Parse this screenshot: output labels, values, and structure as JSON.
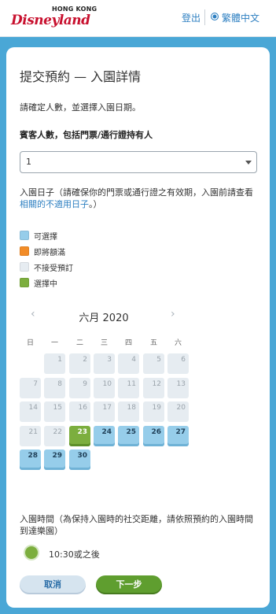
{
  "header": {
    "logo_top": "HONG KONG",
    "logo_main": "Disneyland",
    "logout": "登出",
    "language": "繁體中文"
  },
  "page": {
    "title": "提交預約 — 入園詳情",
    "instruction": "請確定人數，並選擇入園日期。",
    "guest_label": "賓客人數，包括門票/通行證持有人",
    "guest_value": "1",
    "date_note_prefix": "入園日子（請確保你的門票或通行證之有效期，入園前請查看",
    "date_note_link": "相關的不適用日子",
    "date_note_suffix": "。）"
  },
  "legend": [
    {
      "label": "可選擇",
      "color": "#96cdea"
    },
    {
      "label": "即將額滿",
      "color": "#f28c28"
    },
    {
      "label": "不接受預訂",
      "color": "#e6ecf1"
    },
    {
      "label": "選擇中",
      "color": "#7cae3e"
    }
  ],
  "calendar": {
    "month_label": "六月 2020",
    "weekdays": [
      "日",
      "一",
      "二",
      "三",
      "四",
      "五",
      "六"
    ],
    "start_weekday": 1,
    "days_in_month": 30,
    "unavailable_through": 22,
    "selected_day": 23
  },
  "time": {
    "note": "入園時間（為保持入園時的社交距離，請依照預約的入園時間到達樂園）",
    "option": "10:30或之後"
  },
  "buttons": {
    "cancel": "取消",
    "next": "下一步"
  }
}
